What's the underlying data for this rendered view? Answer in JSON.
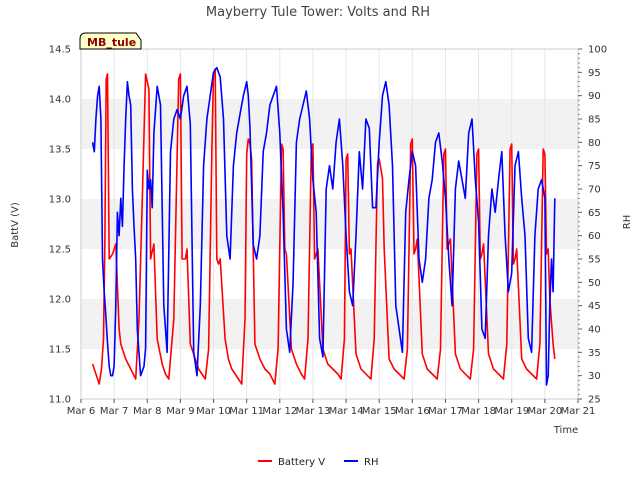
{
  "chart_data": {
    "type": "line",
    "title": "Mayberry Tule Tower: Volts and RH",
    "station_badge": "MB_tule",
    "xlabel": "Time",
    "ylabel_left": "BattV (V)",
    "ylabel_right": "RH",
    "xlim": [
      6,
      21
    ],
    "ylim_left": [
      11.0,
      14.5
    ],
    "ylim_right": [
      25,
      100
    ],
    "x_ticks": [
      6,
      7,
      8,
      9,
      10,
      11,
      12,
      13,
      14,
      15,
      16,
      17,
      18,
      19,
      20,
      21
    ],
    "x_tick_labels": [
      "Mar 6",
      "Mar 7",
      "Mar 8",
      "Mar 9",
      "Mar 10",
      "Mar 11",
      "Mar 12",
      "Mar 13",
      "Mar 14",
      "Mar 15",
      "Mar 16",
      "Mar 17",
      "Mar 18",
      "Mar 19",
      "Mar 20",
      "Mar 21"
    ],
    "y_left_ticks": [
      11.0,
      11.5,
      12.0,
      12.5,
      13.0,
      13.5,
      14.0,
      14.5
    ],
    "y_left_tick_labels": [
      "11.0",
      "11.5",
      "12.0",
      "12.5",
      "13.0",
      "13.5",
      "14.0",
      "14.5"
    ],
    "y_right_ticks": [
      25,
      30,
      35,
      40,
      45,
      50,
      55,
      60,
      65,
      70,
      75,
      80,
      85,
      90,
      95,
      100
    ],
    "y_right_tick_labels": [
      "25",
      "30",
      "35",
      "40",
      "45",
      "50",
      "55",
      "60",
      "65",
      "70",
      "75",
      "80",
      "85",
      "90",
      "95",
      "100"
    ],
    "grid": "horizontal-bands",
    "legend_position": "bottom-center",
    "series": [
      {
        "name": "Battery V",
        "axis": "left",
        "color": "#ff0000",
        "x": [
          6.35,
          6.45,
          6.55,
          6.62,
          6.68,
          6.72,
          6.76,
          6.8,
          6.85,
          6.95,
          7.05,
          7.15,
          7.2,
          7.25,
          7.35,
          7.5,
          7.65,
          7.75,
          7.85,
          7.95,
          8.05,
          8.1,
          8.13,
          8.17,
          8.2,
          8.3,
          8.45,
          8.5,
          8.55,
          8.65,
          8.8,
          8.95,
          9.0,
          9.05,
          9.1,
          9.15,
          9.2,
          9.3,
          9.45,
          9.55,
          9.65,
          9.75,
          9.85,
          9.95,
          10.0,
          10.05,
          10.1,
          10.15,
          10.2,
          10.35,
          10.45,
          10.55,
          10.65,
          10.75,
          10.85,
          10.95,
          11.0,
          11.05,
          11.1,
          11.15,
          11.25,
          11.4,
          11.55,
          11.7,
          11.85,
          11.95,
          12.05,
          12.1,
          12.15,
          12.2,
          12.35,
          12.5,
          12.65,
          12.75,
          12.85,
          12.95,
          13.0,
          13.05,
          13.1,
          13.15,
          13.3,
          13.45,
          13.6,
          13.75,
          13.85,
          13.95,
          14.0,
          14.05,
          14.1,
          14.15,
          14.3,
          14.45,
          14.6,
          14.75,
          14.85,
          14.95,
          15.0,
          15.05,
          15.1,
          15.15,
          15.3,
          15.45,
          15.6,
          15.75,
          15.85,
          15.95,
          16.0,
          16.05,
          16.1,
          16.15,
          16.3,
          16.45,
          16.6,
          16.75,
          16.85,
          16.95,
          17.0,
          17.05,
          17.1,
          17.15,
          17.3,
          17.45,
          17.6,
          17.75,
          17.85,
          17.95,
          18.0,
          18.05,
          18.1,
          18.15,
          18.3,
          18.45,
          18.6,
          18.75,
          18.85,
          18.95,
          19.0,
          19.05,
          19.1,
          19.15,
          19.3,
          19.45,
          19.6,
          19.75,
          19.85,
          19.95,
          20.0,
          20.05,
          20.1,
          20.15,
          20.25,
          20.3
        ],
        "y": [
          11.35,
          11.25,
          11.15,
          11.3,
          11.6,
          12.6,
          14.2,
          14.25,
          12.4,
          12.45,
          12.55,
          11.7,
          11.55,
          11.5,
          11.4,
          11.3,
          11.2,
          11.8,
          13.0,
          14.25,
          14.1,
          12.4,
          12.45,
          12.5,
          12.55,
          11.6,
          11.35,
          11.3,
          11.25,
          11.2,
          11.8,
          14.2,
          14.25,
          12.4,
          12.4,
          12.4,
          12.5,
          11.55,
          11.4,
          11.3,
          11.25,
          11.2,
          11.5,
          13.5,
          14.25,
          14.3,
          12.4,
          12.35,
          12.4,
          11.6,
          11.4,
          11.3,
          11.25,
          11.2,
          11.15,
          11.8,
          13.45,
          13.6,
          13.55,
          13.4,
          11.55,
          11.4,
          11.3,
          11.25,
          11.15,
          11.5,
          13.55,
          13.5,
          12.5,
          12.45,
          11.5,
          11.35,
          11.25,
          11.2,
          11.6,
          13.5,
          13.55,
          12.4,
          12.45,
          12.5,
          11.5,
          11.35,
          11.3,
          11.25,
          11.2,
          11.6,
          13.4,
          13.45,
          12.45,
          12.5,
          11.45,
          11.3,
          11.25,
          11.2,
          11.6,
          13.35,
          13.4,
          13.3,
          13.2,
          12.5,
          11.4,
          11.3,
          11.25,
          11.2,
          11.5,
          13.55,
          13.6,
          12.45,
          12.5,
          12.6,
          11.45,
          11.3,
          11.25,
          11.2,
          11.5,
          13.45,
          13.5,
          12.5,
          12.55,
          12.6,
          11.45,
          11.3,
          11.25,
          11.2,
          11.5,
          13.45,
          13.5,
          12.4,
          12.45,
          12.55,
          11.45,
          11.3,
          11.25,
          11.2,
          11.55,
          13.5,
          13.55,
          12.35,
          12.4,
          12.5,
          11.4,
          11.3,
          11.25,
          11.2,
          11.55,
          13.5,
          13.45,
          12.45,
          12.5,
          12.0,
          11.55,
          11.4
        ]
      },
      {
        "name": "RH",
        "axis": "right",
        "color": "#0000ff",
        "x": [
          6.35,
          6.4,
          6.45,
          6.5,
          6.55,
          6.6,
          6.65,
          6.7,
          6.75,
          6.8,
          6.85,
          6.9,
          6.95,
          7.0,
          7.05,
          7.1,
          7.15,
          7.2,
          7.25,
          7.3,
          7.35,
          7.4,
          7.45,
          7.5,
          7.55,
          7.6,
          7.65,
          7.7,
          7.8,
          7.9,
          7.95,
          8.0,
          8.05,
          8.1,
          8.15,
          8.2,
          8.3,
          8.4,
          8.5,
          8.55,
          8.6,
          8.7,
          8.8,
          8.9,
          9.0,
          9.1,
          9.2,
          9.3,
          9.4,
          9.5,
          9.6,
          9.7,
          9.8,
          9.9,
          10.0,
          10.1,
          10.2,
          10.3,
          10.4,
          10.5,
          10.6,
          10.7,
          10.8,
          10.9,
          11.0,
          11.05,
          11.1,
          11.2,
          11.3,
          11.4,
          11.5,
          11.6,
          11.7,
          11.8,
          11.9,
          12.0,
          12.1,
          12.2,
          12.3,
          12.4,
          12.5,
          12.6,
          12.7,
          12.8,
          12.9,
          13.0,
          13.1,
          13.2,
          13.3,
          13.4,
          13.5,
          13.6,
          13.7,
          13.8,
          13.9,
          14.0,
          14.1,
          14.2,
          14.3,
          14.4,
          14.5,
          14.6,
          14.7,
          14.8,
          14.9,
          15.0,
          15.1,
          15.2,
          15.3,
          15.4,
          15.5,
          15.6,
          15.7,
          15.8,
          15.9,
          16.0,
          16.1,
          16.2,
          16.3,
          16.4,
          16.5,
          16.6,
          16.7,
          16.8,
          16.9,
          17.0,
          17.1,
          17.2,
          17.3,
          17.4,
          17.5,
          17.6,
          17.7,
          17.8,
          17.9,
          18.0,
          18.1,
          18.2,
          18.3,
          18.4,
          18.5,
          18.6,
          18.7,
          18.8,
          18.9,
          19.0,
          19.1,
          19.2,
          19.3,
          19.4,
          19.5,
          19.6,
          19.7,
          19.8,
          19.9,
          20.0,
          20.05,
          20.1,
          20.15,
          20.2,
          20.25,
          20.3
        ],
        "y": [
          80,
          78,
          85,
          90,
          92,
          85,
          55,
          48,
          43,
          37,
          32,
          30,
          30,
          32,
          45,
          65,
          60,
          68,
          62,
          75,
          85,
          93,
          90,
          88,
          70,
          62,
          55,
          40,
          30,
          32,
          36,
          74,
          70,
          72,
          66,
          82,
          92,
          88,
          45,
          40,
          35,
          78,
          85,
          87,
          85,
          90,
          92,
          84,
          35,
          30,
          45,
          75,
          85,
          90,
          95,
          96,
          94,
          85,
          60,
          55,
          75,
          82,
          86,
          90,
          93,
          90,
          83,
          58,
          55,
          60,
          78,
          82,
          88,
          90,
          92,
          82,
          65,
          40,
          35,
          50,
          80,
          85,
          88,
          91,
          85,
          72,
          65,
          38,
          34,
          70,
          75,
          70,
          80,
          85,
          75,
          60,
          48,
          45,
          60,
          78,
          70,
          85,
          83,
          66,
          66,
          80,
          90,
          93,
          88,
          75,
          45,
          40,
          35,
          65,
          72,
          78,
          75,
          55,
          50,
          55,
          68,
          72,
          80,
          82,
          76,
          68,
          55,
          45,
          70,
          76,
          72,
          68,
          82,
          85,
          72,
          63,
          40,
          38,
          60,
          70,
          65,
          72,
          78,
          60,
          48,
          52,
          75,
          78,
          68,
          60,
          38,
          35,
          60,
          70,
          72,
          68,
          28,
          30,
          45,
          55,
          48,
          68
        ]
      }
    ]
  }
}
